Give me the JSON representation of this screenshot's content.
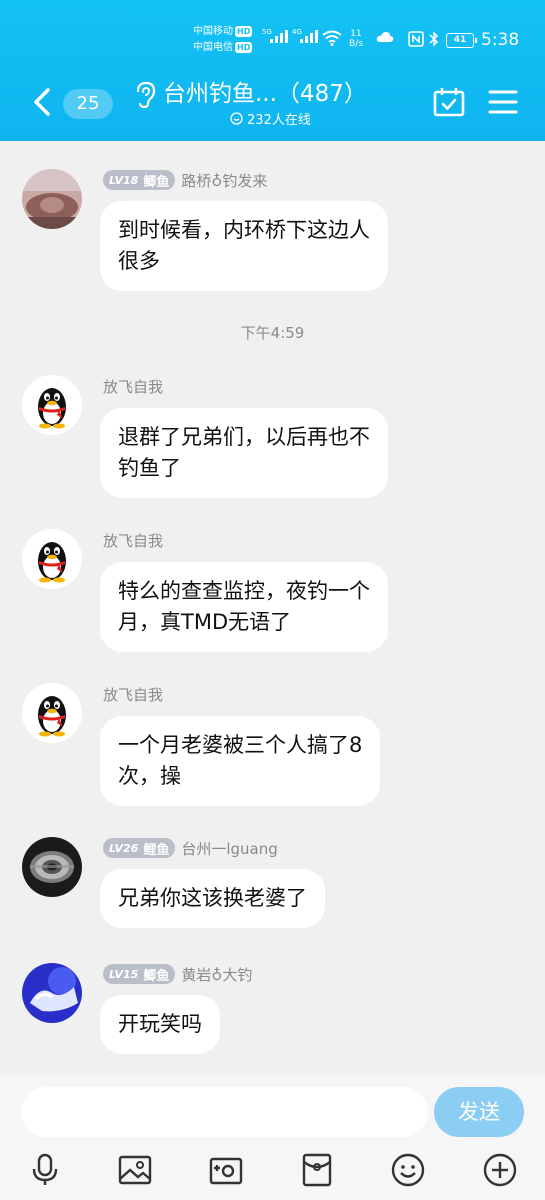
{
  "status_bar": {
    "carrier1": "中国移动",
    "carrier2": "中国电信",
    "hd": "HD",
    "net1": "5G",
    "net2": "4G",
    "speed_value": "11",
    "speed_unit": "B/s",
    "battery": "41",
    "time": "5:38"
  },
  "header": {
    "unread_count": "25",
    "title": "台州钓鱼...（487）",
    "online": "232人在线"
  },
  "messages": [
    {
      "sender": "路桥♁钓发来",
      "level": "LV18",
      "level_title": "鲫鱼",
      "text_lines": [
        "到时候看，内环桥下这边人",
        "很多"
      ]
    },
    {
      "sender": "放飞自我",
      "text_lines": [
        "退群了兄弟们，以后再也不",
        "钓鱼了"
      ]
    },
    {
      "sender": "放飞自我",
      "text_lines": [
        "特么的查查监控，夜钓一个",
        "月，真TMD无语了"
      ]
    },
    {
      "sender": "放飞自我",
      "text_lines": [
        "一个月老婆被三个人搞了8",
        "次，操"
      ]
    },
    {
      "sender": "台州一lguang",
      "level": "LV26",
      "level_title": "鲤鱼",
      "text_lines": [
        "兄弟你这该换老婆了"
      ]
    },
    {
      "sender": "黄岩♁大钓",
      "level": "LV15",
      "level_title": "鲫鱼",
      "text_lines": [
        "开玩笑吗"
      ]
    }
  ],
  "timestamp": "下午4:59",
  "input": {
    "value": "",
    "send_label": "发送"
  },
  "toolbar_icons": [
    "microphone-icon",
    "image-icon",
    "camera-icon",
    "red-packet-icon",
    "emoji-icon",
    "plus-icon"
  ],
  "colors": {
    "header_blue": "#13c2f4",
    "send_button": "#8ccdf3",
    "bubble": "#ffffff",
    "background": "#f0f0f0"
  }
}
